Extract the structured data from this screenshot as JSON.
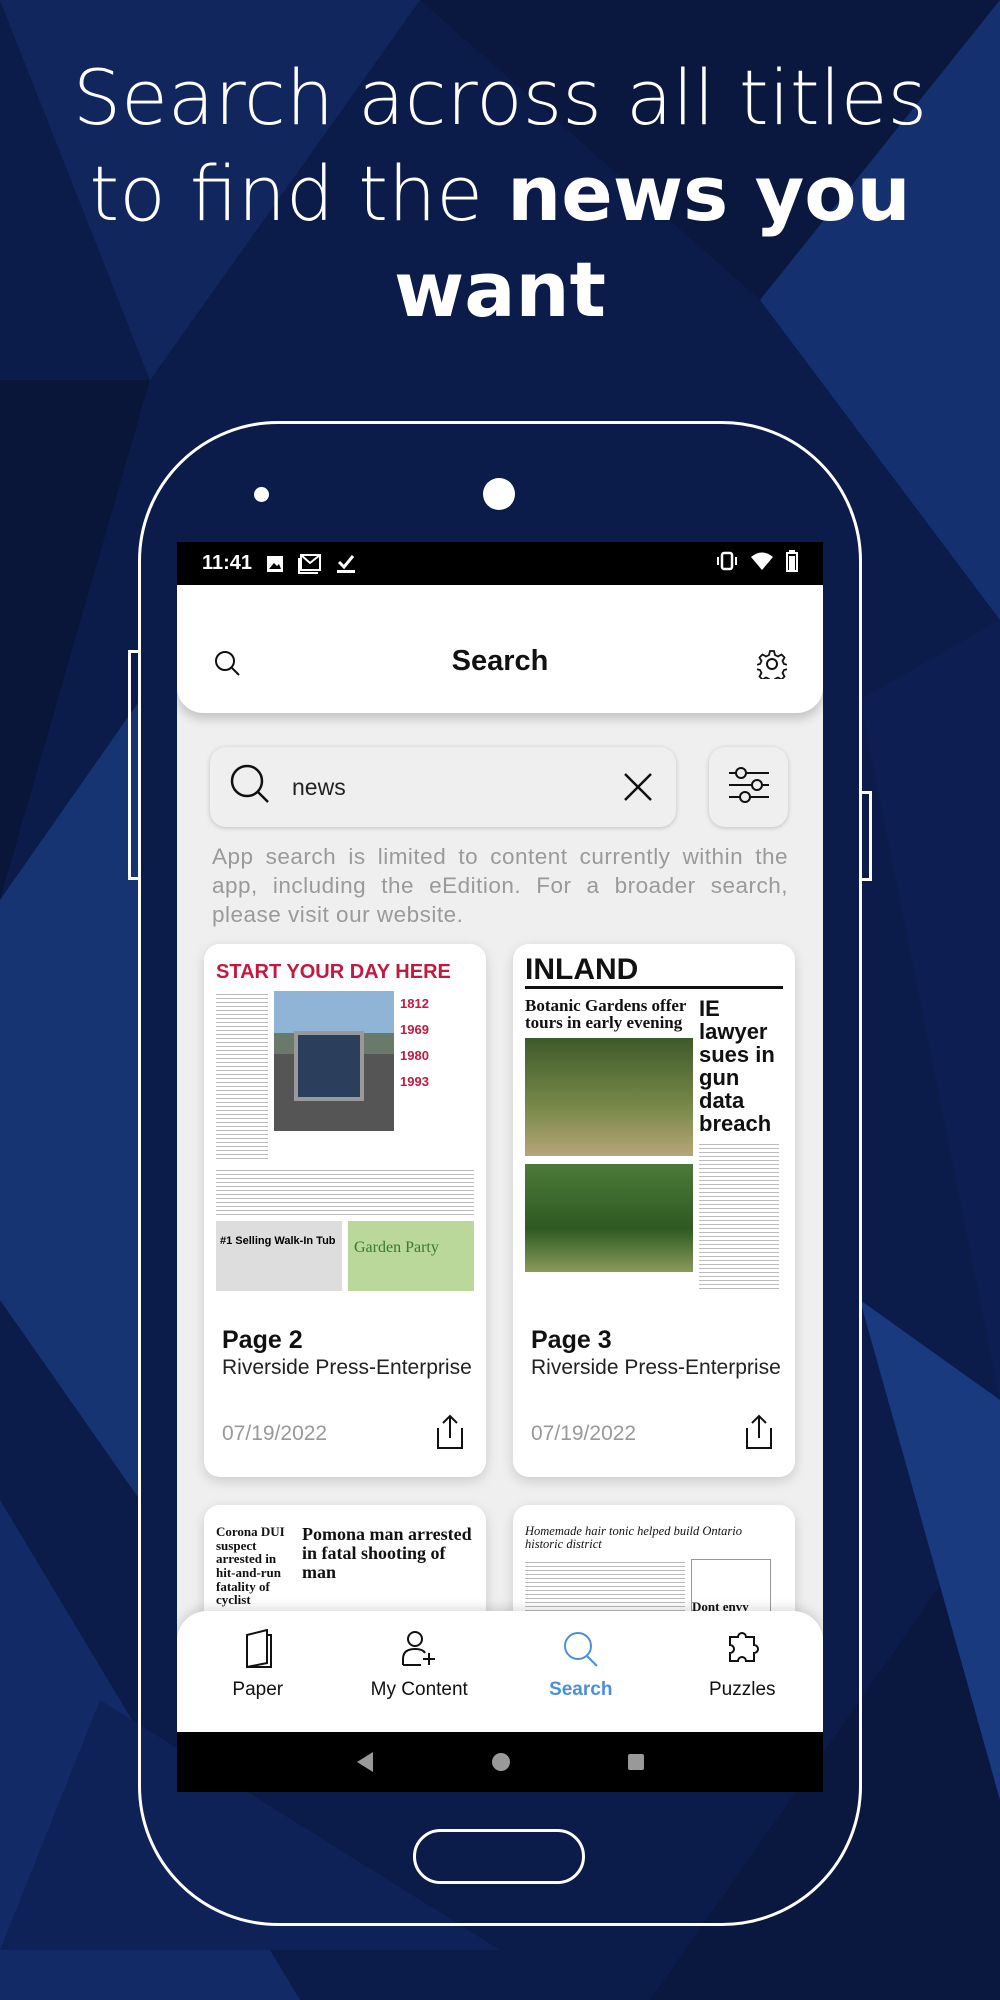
{
  "promo": {
    "line1": "Search across all titles",
    "line2_plain": "to find the ",
    "line2_bold": "news you",
    "line3_bold": "want"
  },
  "status_bar": {
    "time": "11:41"
  },
  "header": {
    "title": "Search"
  },
  "search": {
    "value": "news",
    "disclaimer": "App search is limited to content currently within the app, including the eEdition. For a broader search, please visit our website."
  },
  "results": [
    {
      "page": "Page 2",
      "publication": "Riverside Press-Enterprise",
      "date": "07/19/2022",
      "thumb_headline": "START YOUR DAY HERE",
      "thumb_sub": [
        "1812",
        "1969",
        "1980",
        "1993"
      ],
      "ad1": "#1 Selling Walk-In Tub",
      "ad2": "Garden Party"
    },
    {
      "page": "Page 3",
      "publication": "Riverside Press-Enterprise",
      "date": "07/19/2022",
      "thumb_headline": "INLAND",
      "thumb_sub": [
        "Botanic Gardens offer tours in early evening",
        "IE lawyer sues in gun data breach"
      ]
    },
    {
      "thumb_headline": "Pomona man arrested in fatal shooting of man",
      "thumb_sub": [
        "Corona DUI suspect arrested in hit-and-run fatality of cyclist"
      ]
    },
    {
      "thumb_headline": "Homemade hair tonic helped build Ontario historic district",
      "thumb_sub": [
        "Dont envy beautiful"
      ]
    }
  ],
  "bottom_nav": [
    {
      "label": "Paper",
      "icon": "book-icon"
    },
    {
      "label": "My Content",
      "icon": "user-add-icon"
    },
    {
      "label": "Search",
      "icon": "search-icon",
      "active": true
    },
    {
      "label": "Puzzles",
      "icon": "puzzle-icon"
    }
  ],
  "colors": {
    "accent": "#4a90d9",
    "background": "#0b1a45",
    "newspaper_red": "#c4193f"
  }
}
